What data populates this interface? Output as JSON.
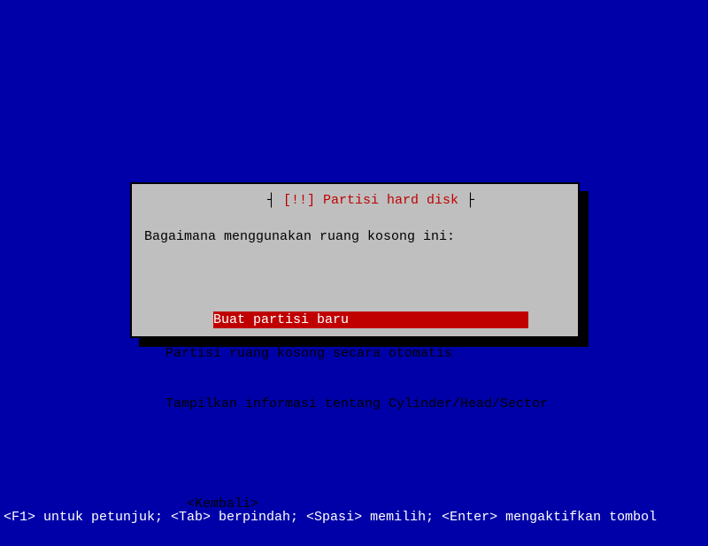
{
  "dialog": {
    "title_marker": "[!!]",
    "title_text": "Partisi hard disk",
    "prompt": "Bagaimana menggunakan ruang kosong ini:",
    "menu": [
      "Buat partisi baru",
      "Partisi ruang kosong secara otomatis",
      "Tampilkan informasi tentang Cylinder/Head/Sector"
    ],
    "back_label": "<Kembali>"
  },
  "footer": "<F1> untuk petunjuk; <Tab> berpindah; <Spasi> memilih; <Enter> mengaktifkan tombol"
}
